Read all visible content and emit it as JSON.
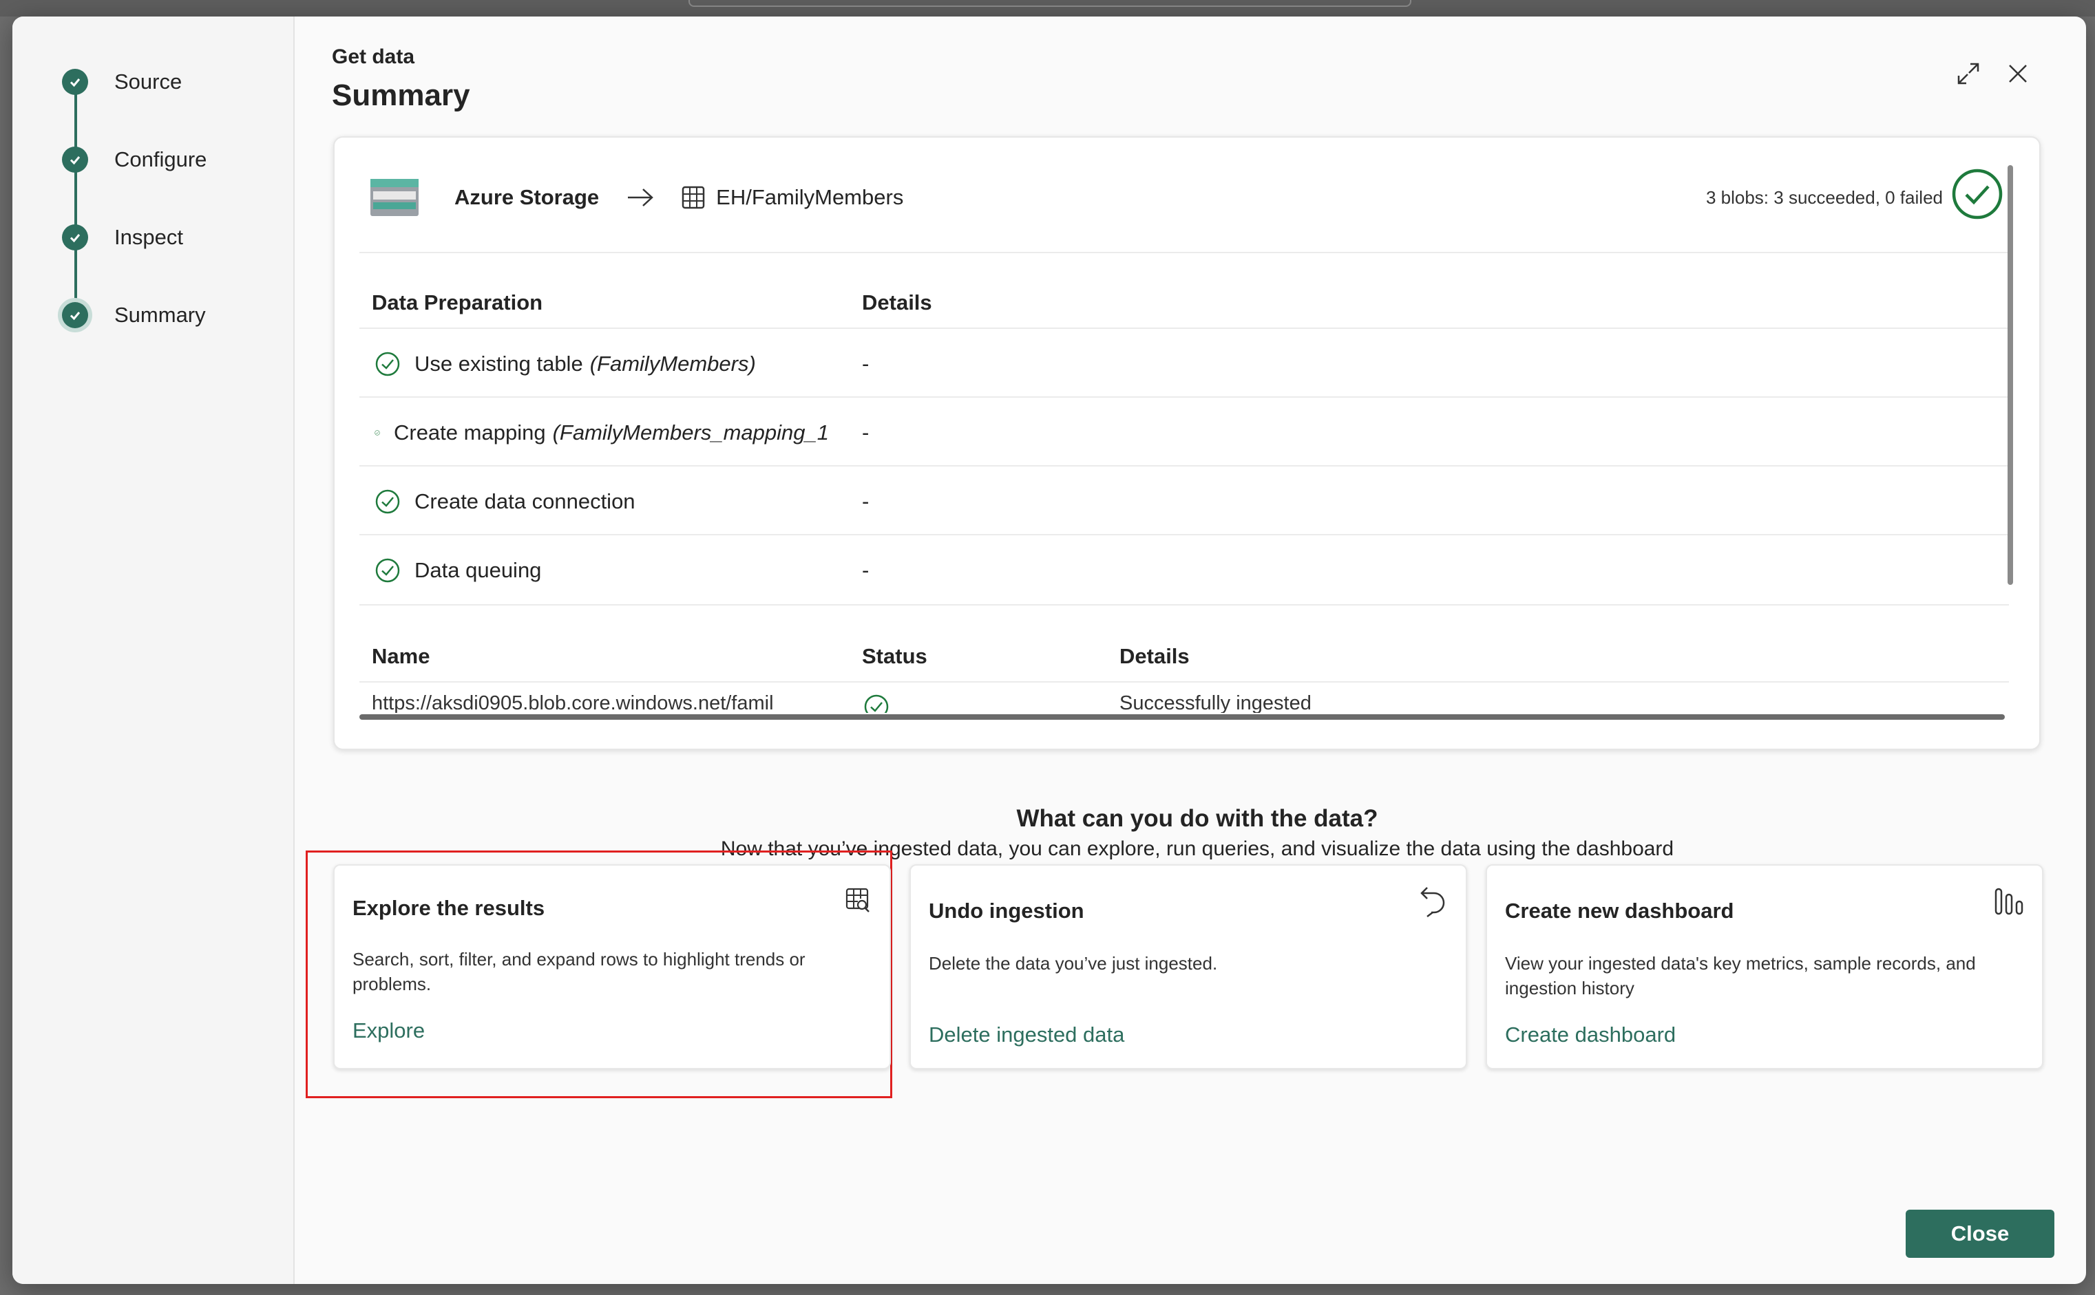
{
  "steps": [
    {
      "label": "Source"
    },
    {
      "label": "Configure"
    },
    {
      "label": "Inspect"
    },
    {
      "label": "Summary"
    }
  ],
  "header": {
    "eyebrow": "Get data",
    "title": "Summary"
  },
  "source": {
    "name": "Azure Storage",
    "destination": "EH/FamilyMembers",
    "status": "3 blobs: 3 succeeded, 0 failed"
  },
  "prep_table": {
    "col1": "Data Preparation",
    "col2": "Details",
    "rows": [
      {
        "text": "Use existing table ",
        "italic": "(FamilyMembers)",
        "details": "-"
      },
      {
        "text": "Create mapping ",
        "italic": "(FamilyMembers_mapping_1",
        "details": "-"
      },
      {
        "text": "Create data connection",
        "italic": "",
        "details": "-"
      },
      {
        "text": "Data queuing",
        "italic": "",
        "details": "-"
      }
    ]
  },
  "blob_table": {
    "col1": "Name",
    "col2": "Status",
    "col3": "Details",
    "rows": [
      {
        "name": "https://aksdi0905.blob.core.windows.net/famil",
        "details": "Successfully ingested"
      }
    ]
  },
  "what_next": {
    "title": "What can you do with the data?",
    "subtitle": "Now that you’ve ingested data, you can explore, run queries, and visualize the data using the dashboard"
  },
  "actions": [
    {
      "title": "Explore the results",
      "desc": "Search, sort, filter, and expand rows to highlight trends or problems.",
      "link": "Explore",
      "icon": "table-search-icon"
    },
    {
      "title": "Undo ingestion",
      "desc": "Delete the data you’ve just ingested.",
      "link": "Delete ingested data",
      "icon": "undo-icon"
    },
    {
      "title": "Create new dashboard",
      "desc": "View your ingested data's key metrics, sample records, and ingestion history",
      "link": "Create dashboard",
      "icon": "bar-chart-icon"
    }
  ],
  "footer": {
    "close_label": "Close"
  },
  "colors": {
    "accent": "#2d6e5e",
    "highlight": "#e02020"
  }
}
